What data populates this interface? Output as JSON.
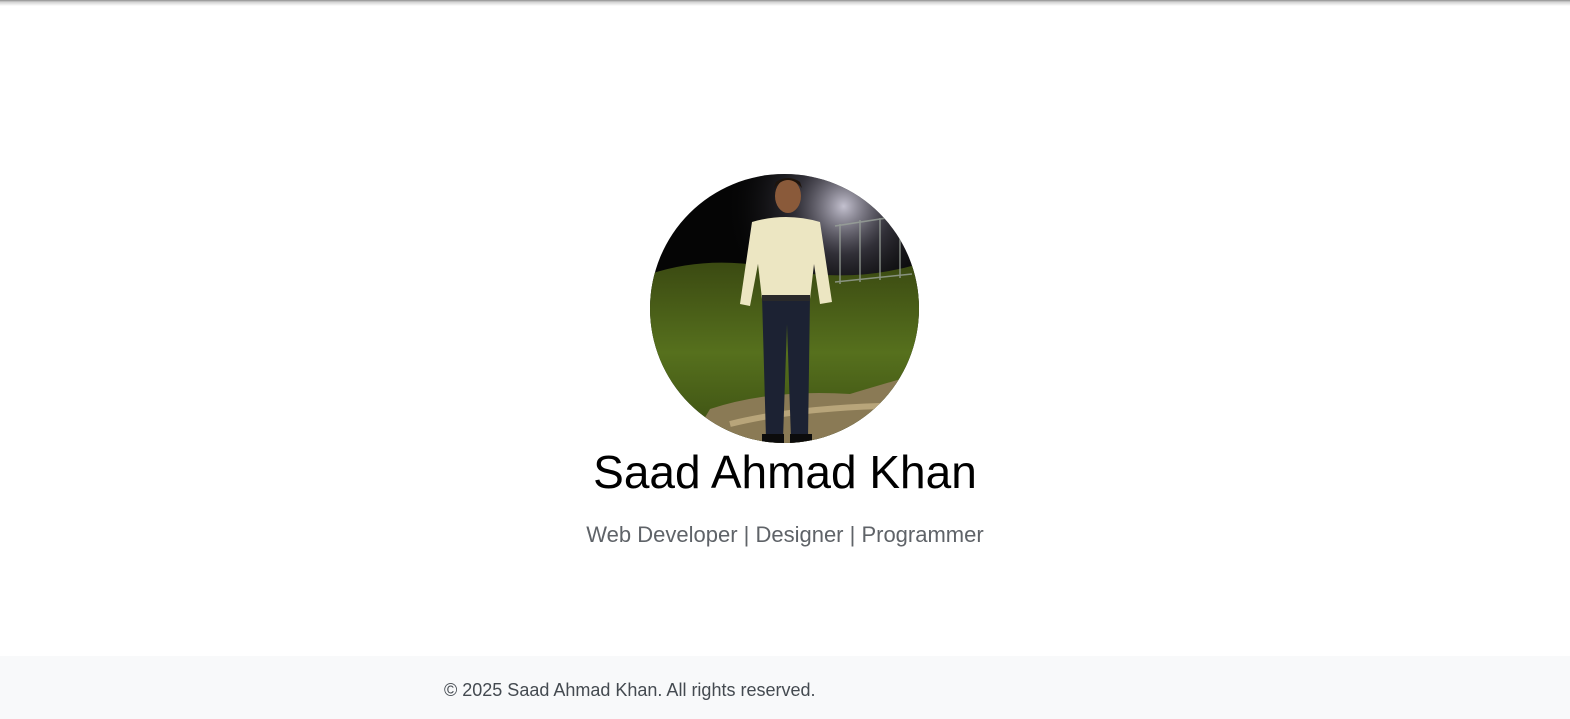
{
  "profile": {
    "name": "Saad Ahmad Khan",
    "tagline": "Web Developer | Designer | Programmer",
    "photo_alt": "Saad Ahmad Khan"
  },
  "footer": {
    "copyright": "© 2025 Saad Ahmad Khan. All rights reserved."
  },
  "colors": {
    "background": "#ffffff",
    "footer_background": "#f8f9fa",
    "name_text": "#000000",
    "tagline_text": "#5f6368",
    "footer_text": "#444a50"
  }
}
